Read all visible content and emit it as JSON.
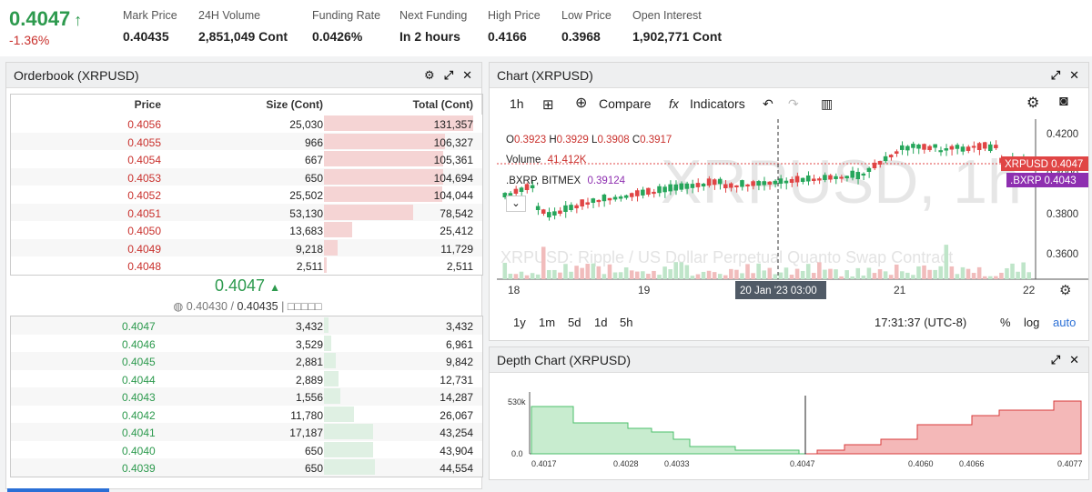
{
  "stats": {
    "last_price": "0.4047",
    "last_arrow": "↑",
    "change": "-1.36%",
    "items": [
      {
        "label": "Mark Price",
        "value": "0.40435"
      },
      {
        "label": "24H Volume",
        "value": "2,851,049 Cont"
      },
      {
        "label": "Funding Rate",
        "value": "0.0426%"
      },
      {
        "label": "Next Funding",
        "value": "In 2 hours"
      },
      {
        "label": "High Price",
        "value": "0.4166"
      },
      {
        "label": "Low Price",
        "value": "0.3968"
      },
      {
        "label": "Open Interest",
        "value": "1,902,771 Cont"
      }
    ]
  },
  "orderbook": {
    "title": "Orderbook (XRPUSD)",
    "headers": {
      "price": "Price",
      "size": "Size (Cont)",
      "total": "Total (Cont)"
    },
    "asks": [
      {
        "price": "0.4056",
        "size": "25,030",
        "total": "131,357",
        "fill": 1.0
      },
      {
        "price": "0.4055",
        "size": "966",
        "total": "106,327",
        "fill": 0.81
      },
      {
        "price": "0.4054",
        "size": "667",
        "total": "105,361",
        "fill": 0.8
      },
      {
        "price": "0.4053",
        "size": "650",
        "total": "104,694",
        "fill": 0.8
      },
      {
        "price": "0.4052",
        "size": "25,502",
        "total": "104,044",
        "fill": 0.79
      },
      {
        "price": "0.4051",
        "size": "53,130",
        "total": "78,542",
        "fill": 0.6
      },
      {
        "price": "0.4050",
        "size": "13,683",
        "total": "25,412",
        "fill": 0.19
      },
      {
        "price": "0.4049",
        "size": "9,218",
        "total": "11,729",
        "fill": 0.09
      },
      {
        "price": "0.4048",
        "size": "2,511",
        "total": "2,511",
        "fill": 0.02
      }
    ],
    "mid_price": "0.4047",
    "mid_arrow": "▲",
    "mark_index": "0.40430",
    "mark_price": "0.40435",
    "mark_sep": "/",
    "mark_suffix": "| □□□□□",
    "bids": [
      {
        "price": "0.4047",
        "size": "3,432",
        "total": "3,432",
        "fill": 0.03
      },
      {
        "price": "0.4046",
        "size": "3,529",
        "total": "6,961",
        "fill": 0.05
      },
      {
        "price": "0.4045",
        "size": "2,881",
        "total": "9,842",
        "fill": 0.08
      },
      {
        "price": "0.4044",
        "size": "2,889",
        "total": "12,731",
        "fill": 0.1
      },
      {
        "price": "0.4043",
        "size": "1,556",
        "total": "14,287",
        "fill": 0.11
      },
      {
        "price": "0.4042",
        "size": "11,780",
        "total": "26,067",
        "fill": 0.2
      },
      {
        "price": "0.4041",
        "size": "17,187",
        "total": "43,254",
        "fill": 0.33
      },
      {
        "price": "0.4040",
        "size": "650",
        "total": "43,904",
        "fill": 0.33
      },
      {
        "price": "0.4039",
        "size": "650",
        "total": "44,554",
        "fill": 0.34
      }
    ]
  },
  "chart": {
    "title": "Chart (XRPUSD)",
    "toolbar": {
      "interval": "1h",
      "compare": "Compare",
      "indicators": "Indicators"
    },
    "ohlc": {
      "o_label": "O",
      "o": "0.3923",
      "h_label": "H",
      "h": "0.3929",
      "l_label": "L",
      "l": "0.3908",
      "c_label": "C",
      "c": "0.3917"
    },
    "volume_label": "Volume",
    "volume_value": "41.412K",
    "index_label": ".BXRP, BITMEX",
    "index_value": "0.39124",
    "watermark_symbol": "XRPUSD, 1h",
    "watermark_desc": "XRPUSD: Ripple / US Dollar Perpetual Quanto Swap Contract",
    "price_tag_symbol": "XRPUSD",
    "price_tag_value": "0.4047",
    "index_tag_symbol": ".BXRP",
    "index_tag_value": "0.4043",
    "y_ticks": [
      "0.4200",
      "0.4000",
      "0.3800",
      "0.3600"
    ],
    "x_ticks": [
      "18",
      "19",
      "21",
      "22"
    ],
    "crosshair_label": "20 Jan '23    03:00",
    "ranges": [
      "1y",
      "1m",
      "5d",
      "1d",
      "5h"
    ],
    "clock": "17:31:37 (UTC-8)",
    "pct": "%",
    "log": "log",
    "auto": "auto",
    "colors": {
      "up": "#26a65b",
      "down": "#e04545",
      "tag_red": "#e04545",
      "tag_purple": "#8e2fb0"
    }
  },
  "depth": {
    "title": "Depth Chart (XRPUSD)",
    "y_ticks": [
      "530k",
      "0.0"
    ],
    "x_ticks": [
      "0.4017",
      "0.4028",
      "0.4033",
      "0.4047",
      "0.4060",
      "0.4066",
      "0.4077"
    ]
  }
}
